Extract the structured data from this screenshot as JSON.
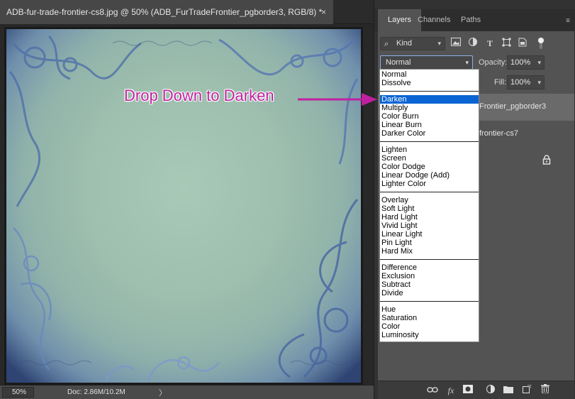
{
  "document": {
    "tab_title": "ADB-fur-trade-frontier-cs8.jpg @ 50% (ADB_FurTradeFrontier_pgborder3, RGB/8) *",
    "close_glyph": "×"
  },
  "status_bar": {
    "zoom": "50%",
    "doc_info": "Doc: 2.86M/10.2M",
    "arrow": "〉"
  },
  "panel": {
    "tabs": [
      "Layers",
      "Channels",
      "Paths"
    ],
    "menu_glyph": "≡",
    "kind_label": "Kind",
    "blend_mode": "Normal",
    "opacity_label": "Opacity:",
    "opacity_value": "100%",
    "fill_label": "Fill:",
    "fill_value": "100%",
    "layers": [
      {
        "name": "Frontier_pgborder3"
      },
      {
        "name": "frontier-cs7"
      }
    ]
  },
  "blend_modes": {
    "groups": [
      [
        "Normal",
        "Dissolve"
      ],
      [
        "Darken",
        "Multiply",
        "Color Burn",
        "Linear Burn",
        "Darker Color"
      ],
      [
        "Lighten",
        "Screen",
        "Color Dodge",
        "Linear Dodge (Add)",
        "Lighter Color"
      ],
      [
        "Overlay",
        "Soft Light",
        "Hard Light",
        "Vivid Light",
        "Linear Light",
        "Pin Light",
        "Hard Mix"
      ],
      [
        "Difference",
        "Exclusion",
        "Subtract",
        "Divide"
      ],
      [
        "Hue",
        "Saturation",
        "Color",
        "Luminosity"
      ]
    ],
    "highlighted": "Darken"
  },
  "annotation": {
    "text": "Drop Down to Darken",
    "color": "#c020a0"
  },
  "colors": {
    "accent_highlight": "#0a64d4",
    "panel_bg": "#535353",
    "canvas_bg": "#282828"
  }
}
